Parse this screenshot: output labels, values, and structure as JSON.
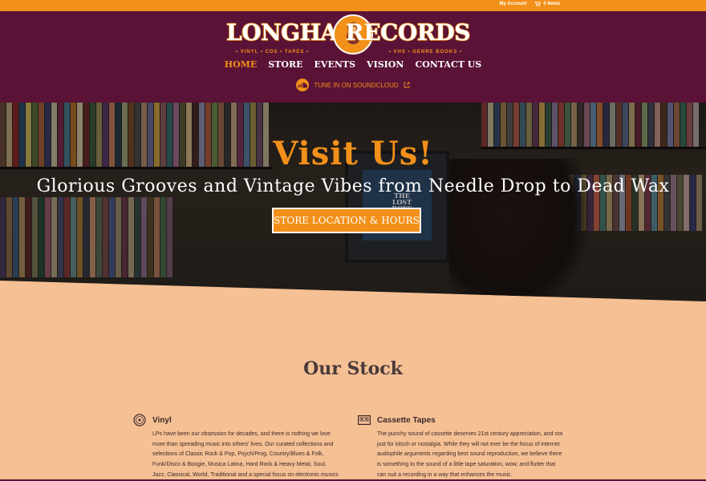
{
  "topbar": {
    "my_account": "My Account",
    "cart": "0 Items"
  },
  "brand": {
    "left_word": "LONGHAIR",
    "right_word": "RECORDS",
    "tagline_left": "• VINYL • CDS • TAPES •",
    "tagline_right": "• VHS • GENRE BOOKS •"
  },
  "nav": {
    "items": [
      "HOME",
      "STORE",
      "EVENTS",
      "VISION",
      "CONTACT US"
    ],
    "active": "HOME"
  },
  "soundcloud": {
    "label": "TUNE IN ON SOUNDCLOUD"
  },
  "hero": {
    "title": "Visit Us!",
    "subtitle": "Glorious Grooves and Vintage Vibes from Needle Drop to Dead Wax",
    "button": "STORE LOCATION & HOURS",
    "tv_text": "THE LOST BOYS"
  },
  "stock": {
    "title": "Our Stock"
  },
  "cards": [
    {
      "title": "Vinyl",
      "icon": "vinyl-record-icon",
      "text": "LPs have been our obsession for decades, and there is nothing we love more than spreading music into others' lives. Our curated collections and selections of Classic Rock & Pop, Psych/Prog, Country/Blues & Folk, Funk/Disco & Boogie, Musica Latina, Hard Rock & Heavy Metal, Soul, Jazz, Classical, World, Traditional and a special focus on electronic musics    be they house,"
    },
    {
      "title": "Cassette Tapes",
      "icon": "cassette-tape-icon",
      "text": "The punchy sound of cassette deserves 21st century appreciation, and not just for kitsch or nostalgia. While they will not ever be the focus of internet audiophile arguments regarding best sound reproduction, we believe there is something to the sound of a little tape saturation, wow, and flutter that can suit a recording in a way that enhances the music."
    }
  ],
  "colors": {
    "accent": "#f39019",
    "header_bg": "#5a1336",
    "page_bg": "#f5c094"
  }
}
